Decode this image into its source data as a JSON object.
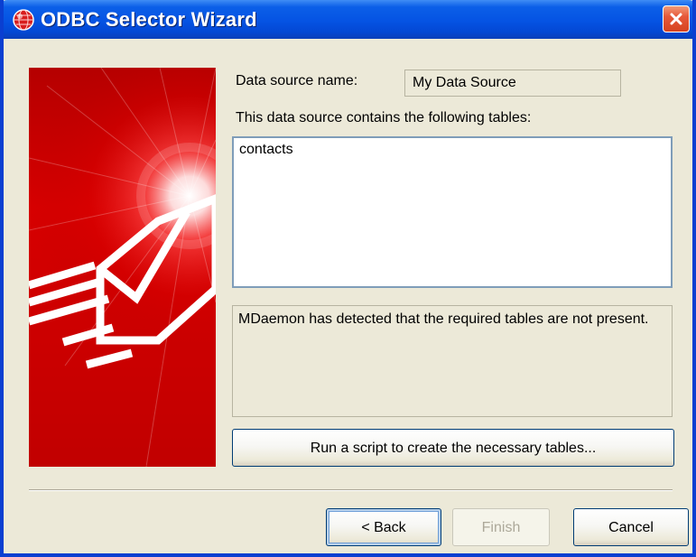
{
  "window": {
    "title": "ODBC Selector Wizard"
  },
  "icons": {
    "app_icon": "globe-badge-icon",
    "close_icon": "close-icon",
    "brand_icon": "mail-envelope-icon"
  },
  "fields": {
    "data_source_name_label": "Data source name:",
    "data_source_name_value": "My Data Source",
    "tables_label": "This data source contains the following tables:"
  },
  "tables": [
    "contacts"
  ],
  "message": "MDaemon has detected that the required tables are not present.",
  "buttons": {
    "run_script": "Run a script to create the necessary tables...",
    "back": "< Back",
    "finish": "Finish",
    "cancel": "Cancel"
  },
  "colors": {
    "title_bar": "#0553e3",
    "brand_red": "#c90000",
    "close_red": "#d6431f",
    "dialog_background": "#ece9d8"
  }
}
